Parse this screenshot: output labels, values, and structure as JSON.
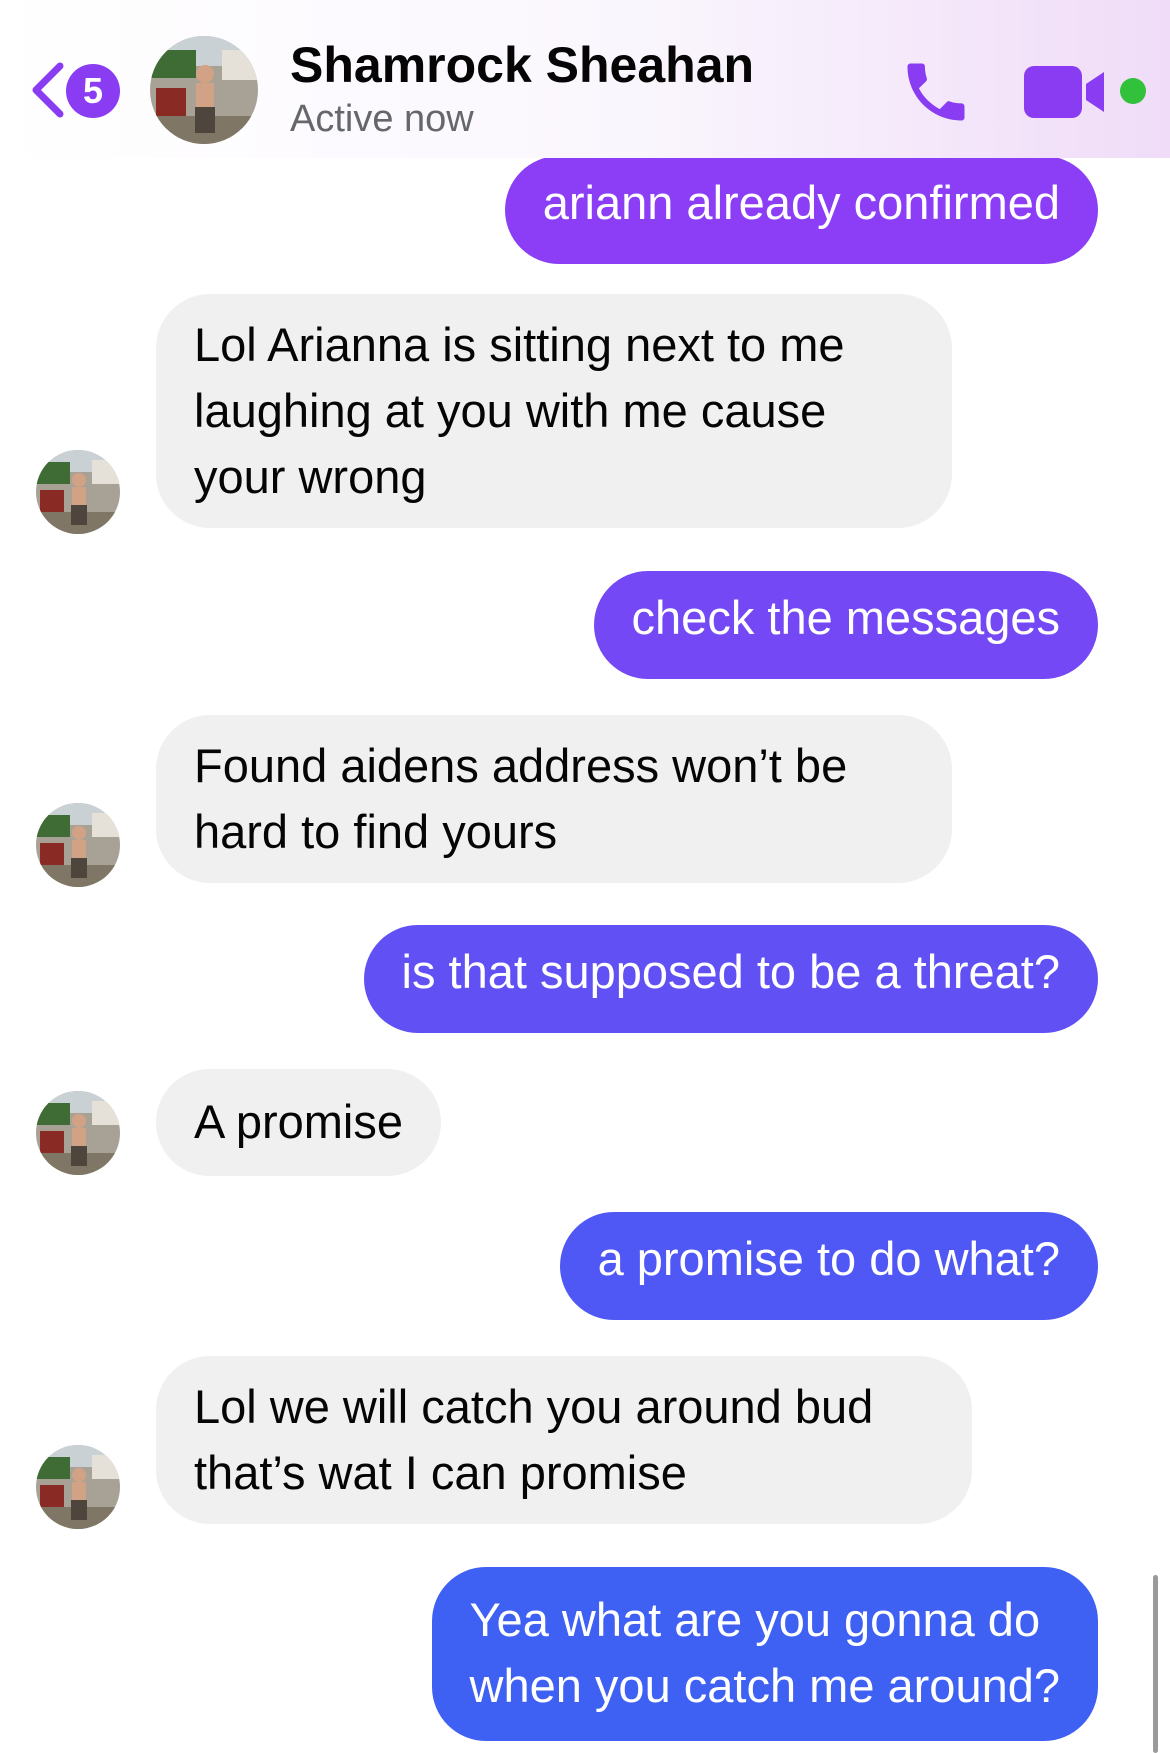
{
  "header": {
    "unread_count": "5",
    "contact_name": "Shamrock Sheahan",
    "status": "Active now",
    "icons": {
      "back": "chevron-left-icon",
      "call": "phone-icon",
      "video": "video-camera-icon"
    },
    "colors": {
      "accent": "#8a3cf3",
      "online": "#31c13b"
    }
  },
  "messages": [
    {
      "direction": "outgoing",
      "text": "ariann already confirmed",
      "color": "#8b3ef5"
    },
    {
      "direction": "incoming",
      "lines": [
        "Lol Arianna is sitting next to me",
        "laughing at you with me cause",
        "your wrong"
      ]
    },
    {
      "direction": "outgoing",
      "text": "check the messages",
      "color": "#7448f5"
    },
    {
      "direction": "incoming",
      "lines": [
        "Found aidens address won’t be",
        "hard to find yours"
      ]
    },
    {
      "direction": "outgoing",
      "text": "is that supposed to be a threat?",
      "color": "#6151f5"
    },
    {
      "direction": "incoming",
      "lines": [
        "A promise"
      ]
    },
    {
      "direction": "outgoing",
      "text": "a promise to do what?",
      "color": "#4f58f5"
    },
    {
      "direction": "incoming",
      "lines": [
        "Lol we will catch you around bud",
        "that’s wat I can promise"
      ]
    },
    {
      "direction": "outgoing",
      "lines": [
        "Yea what are you gonna do",
        "when you catch me around?"
      ],
      "color": "#3e60f3"
    }
  ]
}
